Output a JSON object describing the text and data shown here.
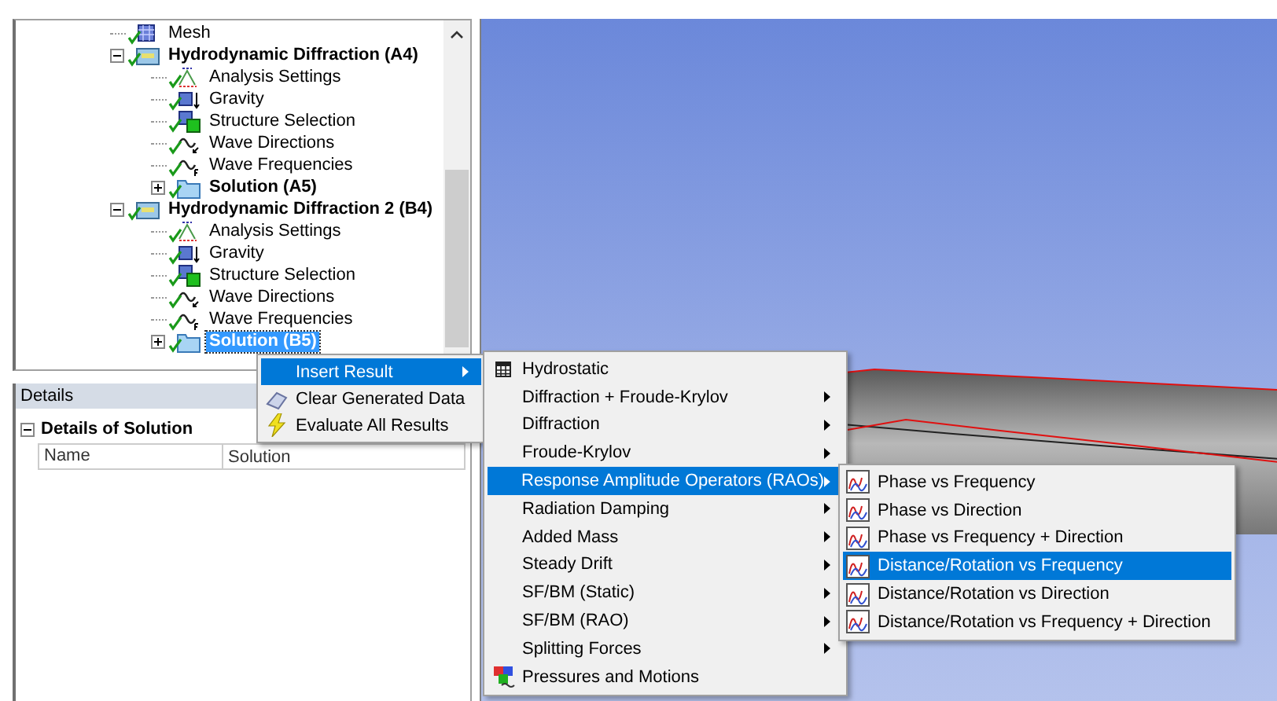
{
  "tree": {
    "items": [
      {
        "label": "Mesh",
        "kind": "mesh",
        "selected": false
      },
      {
        "label": "Hydrodynamic Diffraction (A4)",
        "kind": "analysis",
        "bold": true,
        "expanded": true,
        "selected": false,
        "children": [
          {
            "label": "Analysis Settings",
            "kind": "settings",
            "selected": false
          },
          {
            "label": "Gravity",
            "kind": "gravity",
            "selected": false
          },
          {
            "label": "Structure Selection",
            "kind": "structure",
            "selected": false
          },
          {
            "label": "Wave Directions",
            "kind": "wave_dir",
            "selected": false
          },
          {
            "label": "Wave Frequencies",
            "kind": "wave_freq",
            "selected": false
          },
          {
            "label": "Solution (A5)",
            "kind": "solution",
            "bold": true,
            "expanded": false,
            "selected": false
          }
        ]
      },
      {
        "label": "Hydrodynamic Diffraction 2 (B4)",
        "kind": "analysis",
        "bold": true,
        "expanded": true,
        "selected": false,
        "children": [
          {
            "label": "Analysis Settings",
            "kind": "settings",
            "selected": false
          },
          {
            "label": "Gravity",
            "kind": "gravity",
            "selected": false
          },
          {
            "label": "Structure Selection",
            "kind": "structure",
            "selected": false
          },
          {
            "label": "Wave Directions",
            "kind": "wave_dir",
            "selected": false
          },
          {
            "label": "Wave Frequencies",
            "kind": "wave_freq",
            "selected": false
          },
          {
            "label": "Solution (B5)",
            "kind": "solution",
            "bold": true,
            "expanded": false,
            "selected": true
          }
        ]
      }
    ]
  },
  "details": {
    "title": "Details",
    "section": {
      "title": "Details of Solution",
      "expanded": true
    },
    "rows": [
      {
        "name": "Name",
        "value": "Solution"
      }
    ]
  },
  "context_menu": [
    {
      "label": "Insert Result",
      "kind": "none",
      "submenu": true,
      "selected": true
    },
    {
      "label": "Clear Generated Data",
      "kind": "eraser",
      "submenu": false,
      "selected": false
    },
    {
      "label": "Evaluate All Results",
      "kind": "bolt",
      "submenu": false,
      "selected": false
    }
  ],
  "insert_menu": [
    {
      "label": "Hydrostatic",
      "kind": "table",
      "submenu": false,
      "selected": false
    },
    {
      "label": "Diffraction + Froude-Krylov",
      "kind": "none",
      "submenu": true,
      "selected": false
    },
    {
      "label": "Diffraction",
      "kind": "none",
      "submenu": true,
      "selected": false
    },
    {
      "label": "Froude-Krylov",
      "kind": "none",
      "submenu": true,
      "selected": false
    },
    {
      "label": "Response Amplitude Operators (RAOs)",
      "kind": "none",
      "submenu": true,
      "selected": true
    },
    {
      "label": "Radiation Damping",
      "kind": "none",
      "submenu": true,
      "selected": false
    },
    {
      "label": "Added Mass",
      "kind": "none",
      "submenu": true,
      "selected": false
    },
    {
      "label": "Steady Drift",
      "kind": "none",
      "submenu": true,
      "selected": false
    },
    {
      "label": "SF/BM (Static)",
      "kind": "none",
      "submenu": true,
      "selected": false
    },
    {
      "label": "SF/BM (RAO)",
      "kind": "none",
      "submenu": true,
      "selected": false
    },
    {
      "label": "Splitting Forces",
      "kind": "none",
      "submenu": true,
      "selected": false
    },
    {
      "label": "Pressures and Motions",
      "kind": "cubes",
      "submenu": false,
      "selected": false
    }
  ],
  "rao_menu": [
    {
      "label": "Phase vs Frequency",
      "kind": "chart",
      "selected": false
    },
    {
      "label": "Phase vs Direction",
      "kind": "chart",
      "selected": false
    },
    {
      "label": "Phase vs Frequency + Direction",
      "kind": "chart",
      "selected": false
    },
    {
      "label": "Distance/Rotation vs Frequency",
      "kind": "chart",
      "selected": true
    },
    {
      "label": "Distance/Rotation vs Direction",
      "kind": "chart",
      "selected": false
    },
    {
      "label": "Distance/Rotation vs Frequency + Direction",
      "kind": "chart",
      "selected": false
    }
  ]
}
